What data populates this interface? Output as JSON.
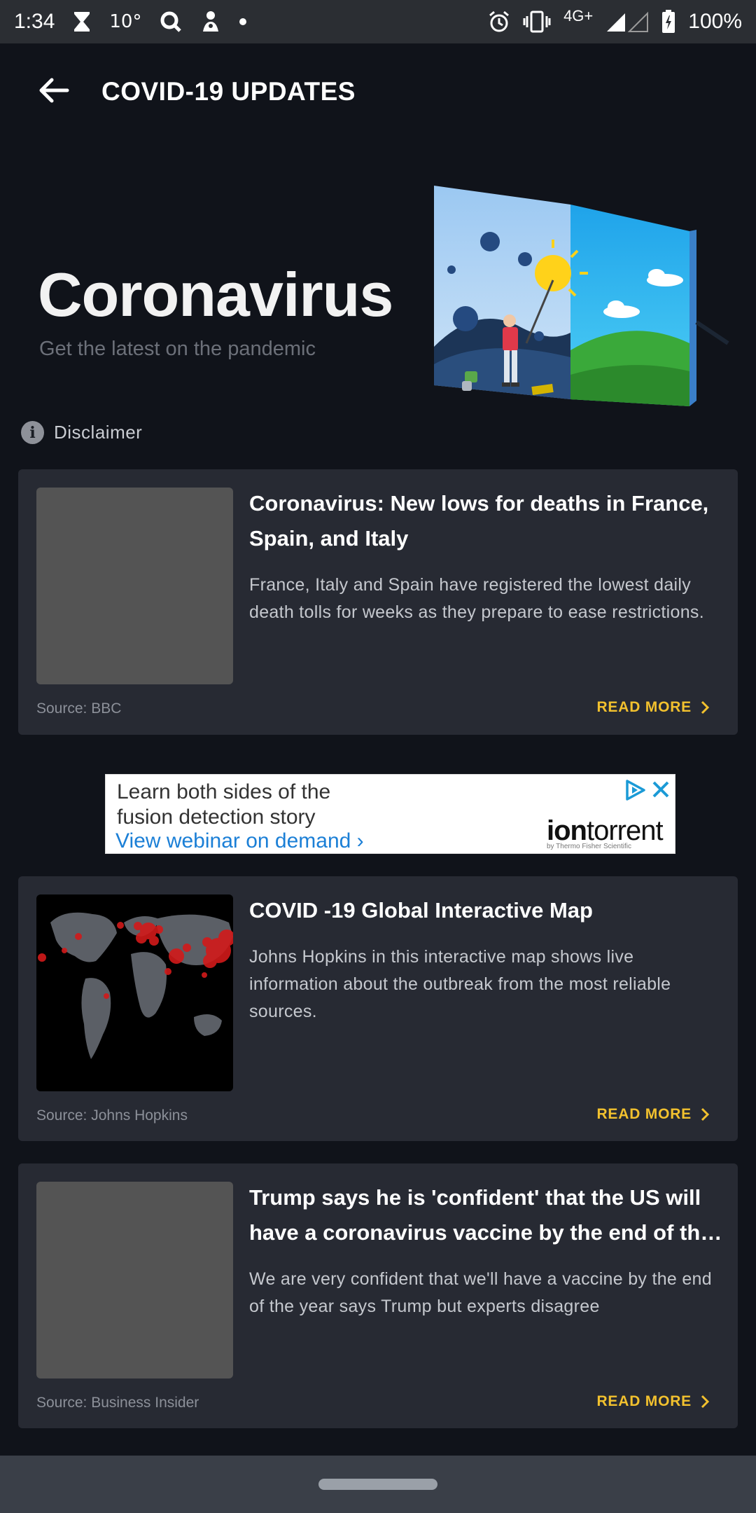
{
  "status_bar": {
    "time": "1:34",
    "temperature": "10°",
    "battery": "100%",
    "network": "4G+",
    "icons": [
      "hourglass-icon",
      "search-icon",
      "gesture-icon",
      "dot-icon",
      "alarm-icon",
      "vibrate-icon",
      "signal-icon",
      "battery-icon"
    ]
  },
  "app_bar": {
    "title": "COVID-19 UPDATES",
    "back_icon": "arrow-left-icon"
  },
  "hero": {
    "title": "Coronavirus",
    "subtitle": "Get the latest on the pandemic"
  },
  "disclaimer": {
    "label": "Disclaimer",
    "icon": "info-icon"
  },
  "articles": [
    {
      "title": "Coronavirus: New lows for deaths in France, Spain, and Italy",
      "description": "France, Italy and Spain have registered the lowest daily death tolls for weeks as they prepare to ease restrictions.",
      "source": "Source: BBC",
      "read_more": "READ MORE"
    },
    {
      "title": "COVID -19 Global Interactive Map",
      "description": "Johns Hopkins in this interactive map shows live information about the outbreak from the most reliable sources.",
      "source": "Source: Johns Hopkins",
      "read_more": "READ MORE"
    },
    {
      "title": "Trump says he is 'confident' that the US will have a coronavirus vaccine by the end of the year",
      "description": "We are very confident that we'll have a vaccine by the end  of the year says Trump but experts disagree",
      "source": "Source: Business Insider",
      "read_more": "READ MORE"
    }
  ],
  "ad": {
    "line1": "Learn both sides of the",
    "line2": "fusion detection story",
    "cta": "View webinar on demand ›",
    "brand_bold": "ion",
    "brand_rest": "torrent",
    "tagline": "by Thermo Fisher Scientific"
  },
  "colors": {
    "background": "#10131a",
    "card": "#272a33",
    "accent": "#f2c12e",
    "ad_link": "#1b7fd6"
  }
}
